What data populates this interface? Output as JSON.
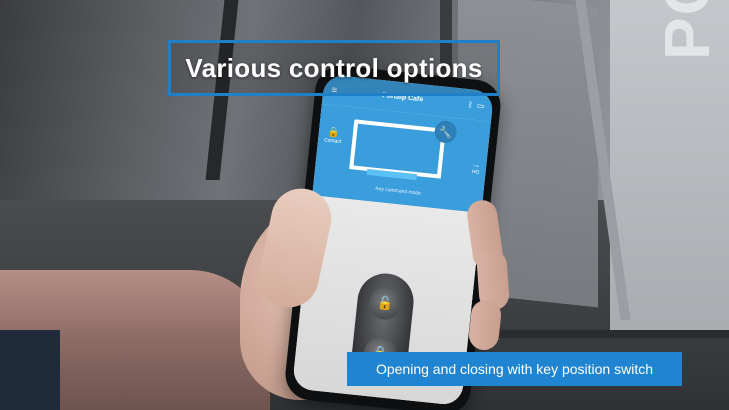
{
  "overlay": {
    "title": "Various control options",
    "caption": "Opening and closing with key position switch",
    "accent_color": "#1f84d2"
  },
  "phone_app": {
    "title": "Portalp Cafe",
    "left_control_label": "Contact",
    "right_control_label": "HO",
    "status_text": "Key command mode",
    "icons": [
      "menu-icon",
      "bluetooth-icon",
      "battery-icon",
      "wrench-icon",
      "lock-icon",
      "arrow-icon",
      "unlock-icon",
      "lock-icon"
    ]
  },
  "background": {
    "sign_text": "PORTO"
  }
}
